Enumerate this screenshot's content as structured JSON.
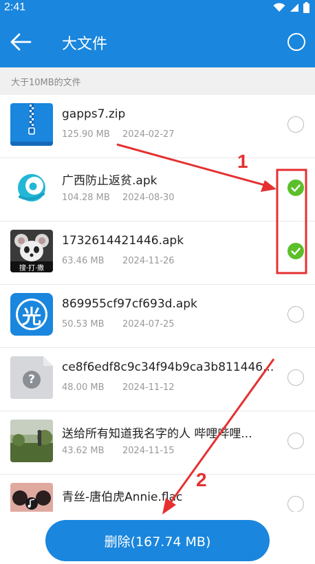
{
  "status": {
    "time": "2:41"
  },
  "header": {
    "title": "大文件"
  },
  "section": {
    "label": "大于10MB的文件"
  },
  "files": [
    {
      "name": "gapps7.zip",
      "size": "125.90 MB",
      "date": "2024-02-27",
      "selected": false,
      "icon": "zip-file-icon"
    },
    {
      "name": "广西防止返贫.apk",
      "size": "104.28 MB",
      "date": "2024-08-30",
      "selected": true,
      "icon": "app-logo-icon"
    },
    {
      "name": "1732614421446.apk",
      "size": "63.46 MB",
      "date": "2024-11-26",
      "selected": true,
      "icon": "mouse-game-icon",
      "badge": "搜·打·撒"
    },
    {
      "name": "869955cf97cf693d.apk",
      "size": "50.53 MB",
      "date": "2024-07-25",
      "selected": false,
      "icon": "guang-app-icon",
      "glyph": "光"
    },
    {
      "name": "ce8f6edf8c9c34f94b9ca3b811446...",
      "size": "48.00 MB",
      "date": "2024-11-12",
      "selected": false,
      "icon": "unknown-file-icon",
      "glyph": "?"
    },
    {
      "name": "送给所有知道我名字的人 哔哩哔哩...",
      "size": "43.62 MB",
      "date": "2024-11-15",
      "selected": false,
      "icon": "video-thumbnail"
    },
    {
      "name": "青丝-唐伯虎Annie.flac",
      "size": "",
      "date": "",
      "selected": false,
      "icon": "music-thumbnail"
    }
  ],
  "footer": {
    "delete_label": "删除(167.74 MB)"
  },
  "annotations": {
    "label1": "1",
    "label2": "2"
  },
  "colors": {
    "primary": "#1a86dd",
    "check": "#5cbf2a",
    "annotation": "#e53030"
  }
}
